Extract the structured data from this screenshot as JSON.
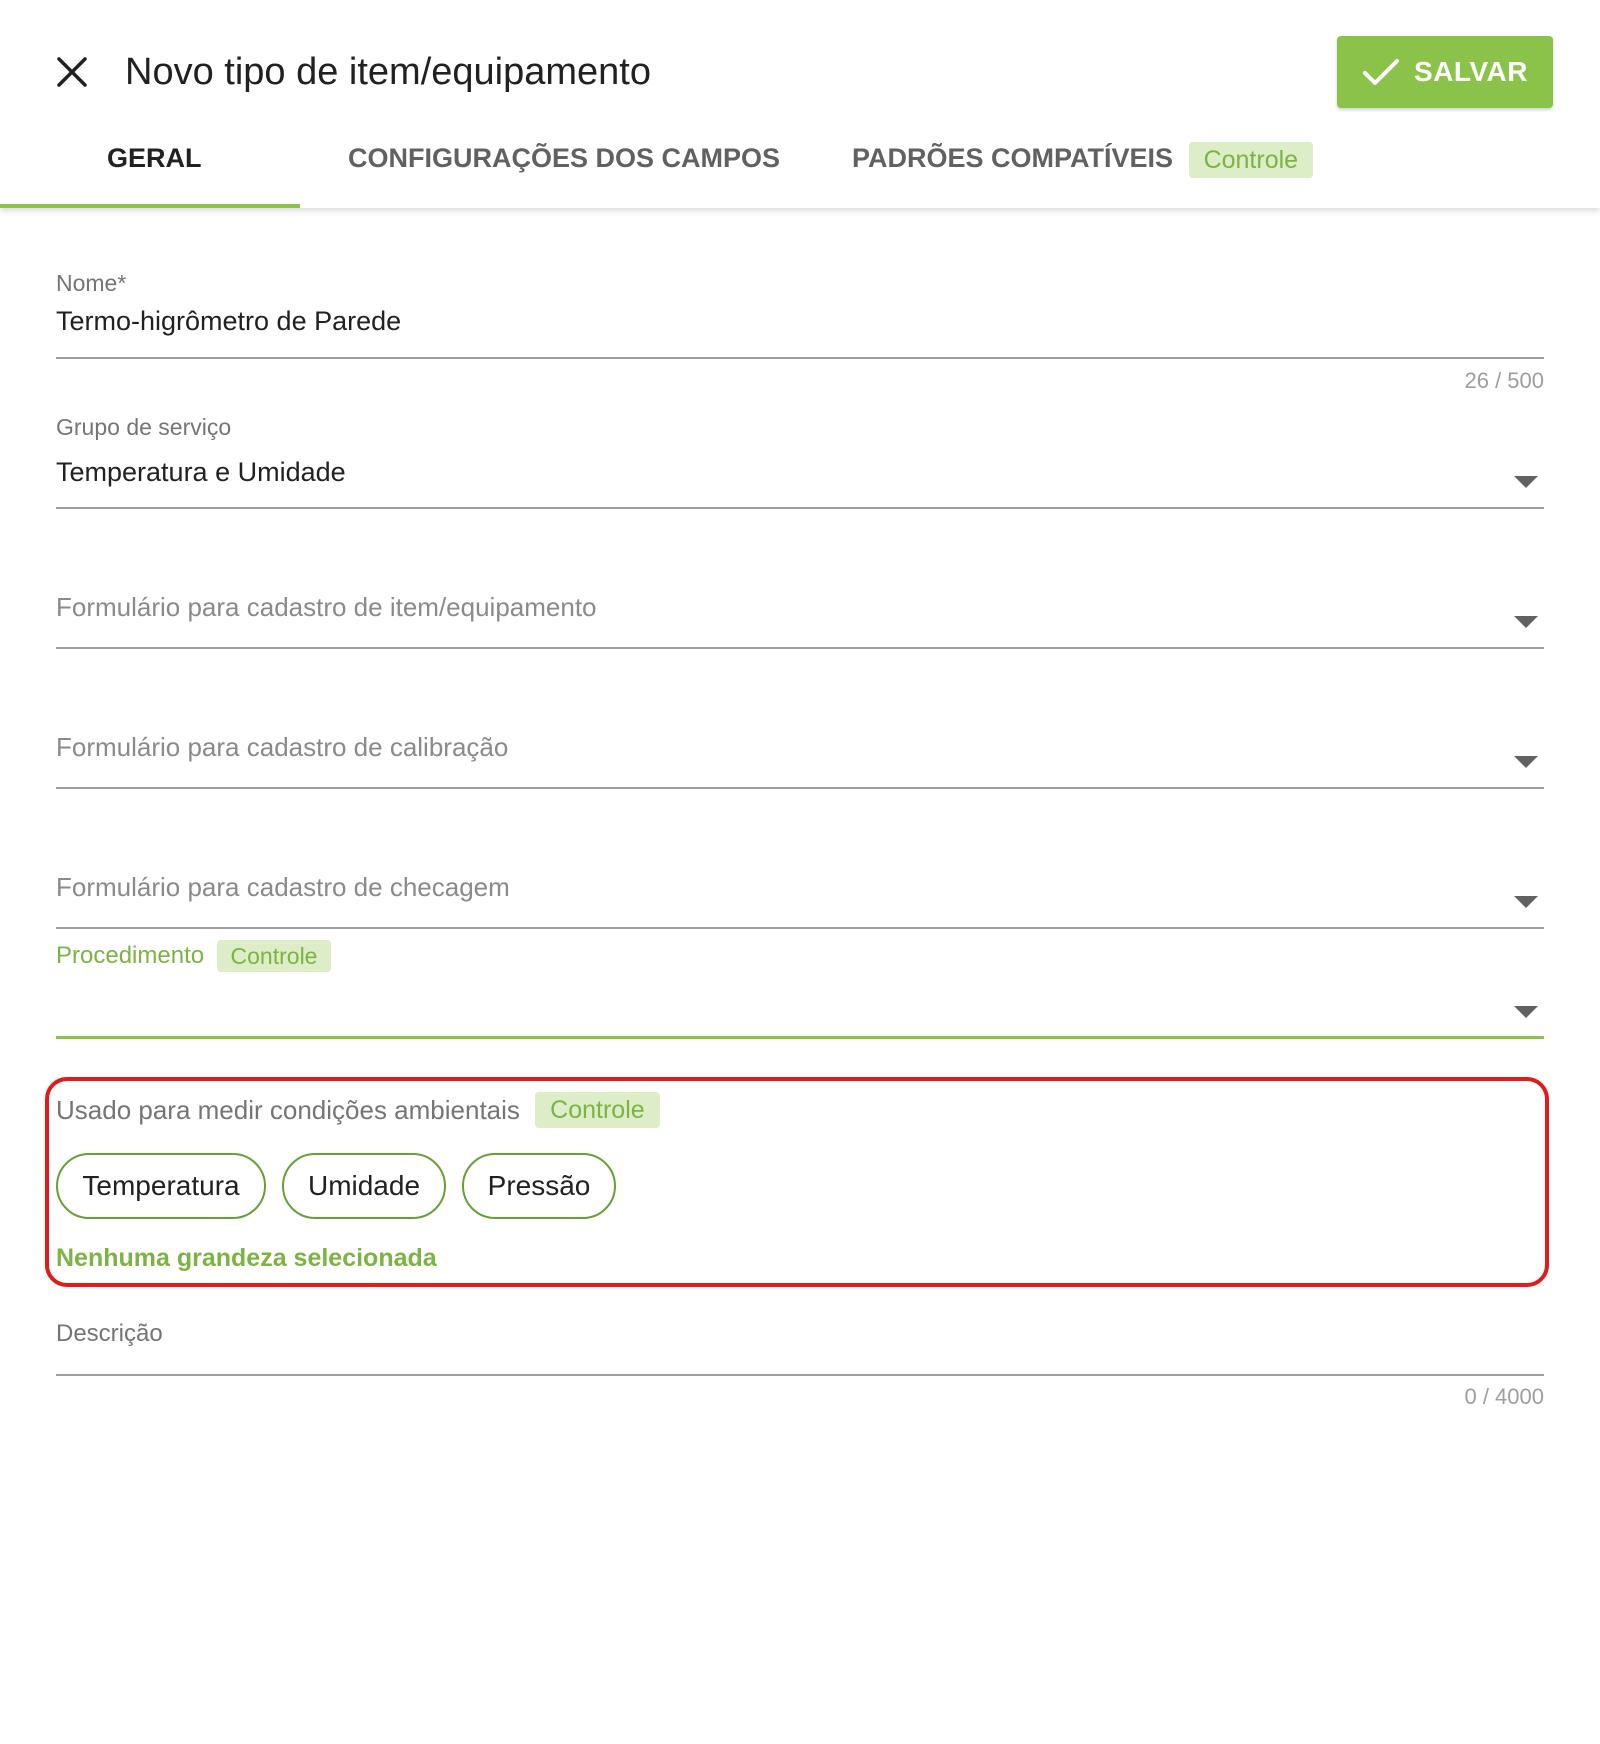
{
  "header": {
    "title": "Novo tipo de item/equipamento",
    "save_label": "SALVAR",
    "close_icon": "close-icon",
    "save_icon": "check-icon"
  },
  "tabs": [
    {
      "label": "GERAL",
      "active": true
    },
    {
      "label": "CONFIGURAÇÕES DOS CAMPOS",
      "active": false
    },
    {
      "label": "PADRÕES COMPATÍVEIS",
      "active": false,
      "badge": "Controle"
    }
  ],
  "form": {
    "nome": {
      "label": "Nome*",
      "value": "Termo-higrômetro de Parede",
      "counter": "26 / 500"
    },
    "grupo": {
      "label": "Grupo de serviço",
      "value": "Temperatura e Umidade"
    },
    "form_item": {
      "placeholder": "Formulário para cadastro de item/equipamento"
    },
    "form_calib": {
      "placeholder": "Formulário para cadastro de calibração"
    },
    "form_check": {
      "placeholder": "Formulário para cadastro de checagem"
    },
    "procedimento": {
      "label": "Procedimento",
      "badge": "Controle"
    },
    "env": {
      "label": "Usado para medir condições ambientais",
      "badge": "Controle",
      "chips": [
        "Temperatura",
        "Umidade",
        "Pressão"
      ],
      "hint": "Nenhuma grandeza selecionada"
    },
    "descricao": {
      "label": "Descrição",
      "counter": "0 / 4000"
    }
  },
  "colors": {
    "accent": "#8bc34a",
    "badge_bg": "#dcedc8",
    "badge_text": "#7cb342",
    "highlight_border": "#e01b1b"
  }
}
